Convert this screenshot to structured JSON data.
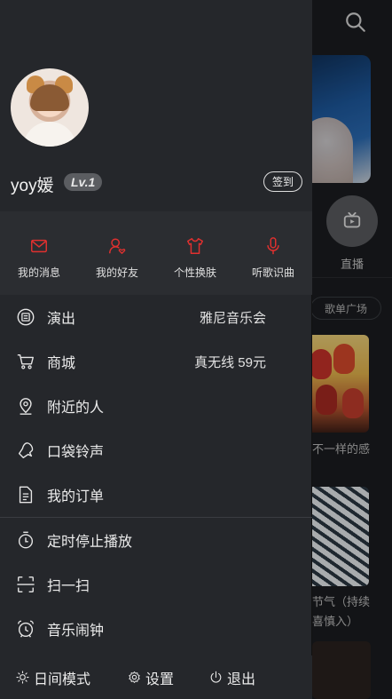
{
  "profile": {
    "username": "yoy媛",
    "level": "Lv.1",
    "checkin_label": "签到"
  },
  "quick_actions": [
    {
      "label": "我的消息",
      "icon": "mail-icon"
    },
    {
      "label": "我的好友",
      "icon": "friends-icon"
    },
    {
      "label": "个性换肤",
      "icon": "shirt-icon"
    },
    {
      "label": "听歌识曲",
      "icon": "microphone-icon"
    }
  ],
  "menu": {
    "group1": [
      {
        "label": "演出",
        "extra": "雅尼音乐会",
        "icon": "ticket-icon"
      },
      {
        "label": "商城",
        "extra": "真无线 59元",
        "icon": "cart-icon"
      },
      {
        "label": "附近的人",
        "extra": "",
        "icon": "location-icon"
      },
      {
        "label": "口袋铃声",
        "extra": "",
        "icon": "bell-icon"
      },
      {
        "label": "我的订单",
        "extra": "",
        "icon": "document-icon"
      }
    ],
    "group2": [
      {
        "label": "定时停止播放",
        "icon": "timer-icon"
      },
      {
        "label": "扫一扫",
        "icon": "scan-icon"
      },
      {
        "label": "音乐闹钟",
        "icon": "alarm-icon"
      }
    ]
  },
  "bottom_bar": {
    "day_mode": "日间模式",
    "settings": "设置",
    "logout": "退出"
  },
  "background": {
    "live_label": "直播",
    "playlist_square": "歌单广场",
    "caption1": "不一样的感",
    "caption2_line1": "节气（持续",
    "caption2_line2": "喜慎入）"
  },
  "colors": {
    "accent": "#e0302f",
    "drawer_bg": "#25272b",
    "quick_bg": "#2b2d31"
  }
}
